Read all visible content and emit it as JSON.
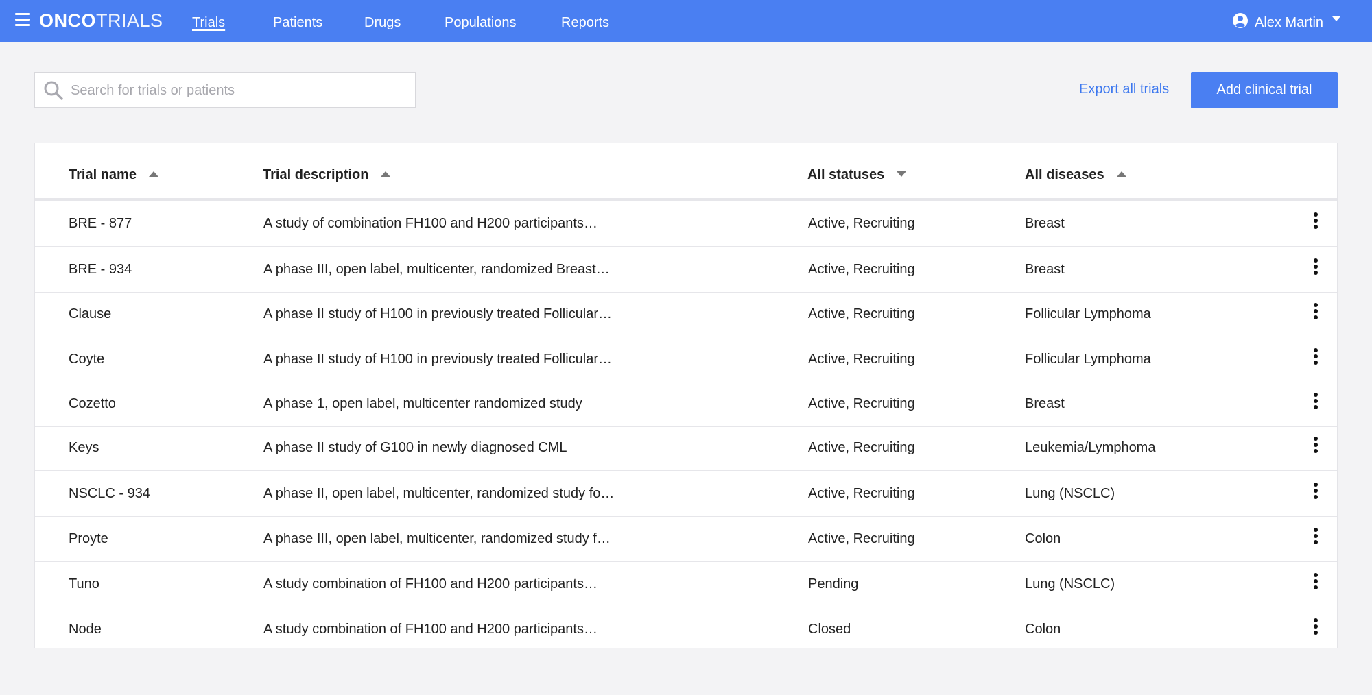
{
  "app": {
    "logo_bold": "ONCO",
    "logo_light": "TRIALS"
  },
  "nav": {
    "items": [
      "Trials",
      "Patients",
      "Drugs",
      "Populations",
      "Reports"
    ],
    "active": "Trials"
  },
  "user": {
    "name": "Alex Martin",
    "icon": "user-circle-icon"
  },
  "toolbar": {
    "search_placeholder": "Search for trials or patients",
    "search_value": "",
    "export_label": "Export all trials",
    "add_label": "Add clinical trial"
  },
  "table": {
    "headers": [
      {
        "label": "Trial name",
        "sort": "asc"
      },
      {
        "label": "Trial description",
        "sort": "asc"
      },
      {
        "label": "All statuses",
        "sort": "desc"
      },
      {
        "label": "All diseases",
        "sort": "asc"
      }
    ],
    "rows": [
      {
        "name": "BRE - 877",
        "description": "A study of combination FH100 and H200 participants…",
        "status": "Active, Recruiting",
        "disease": "Breast"
      },
      {
        "name": "BRE - 934",
        "description": "A phase III, open label, multicenter, randomized Breast…",
        "status": "Active, Recruiting",
        "disease": "Breast"
      },
      {
        "name": "Clause",
        "description": "A phase II study of H100 in previously treated Follicular…",
        "status": "Active, Recruiting",
        "disease": "Follicular Lymphoma"
      },
      {
        "name": "Coyte",
        "description": "A phase II study of H100 in previously treated Follicular…",
        "status": "Active, Recruiting",
        "disease": "Follicular Lymphoma"
      },
      {
        "name": "Cozetto",
        "description": "A phase 1, open label, multicenter randomized study",
        "status": "Active, Recruiting",
        "disease": "Breast"
      },
      {
        "name": "Keys",
        "description": "A phase II study of G100 in newly diagnosed CML",
        "status": "Active, Recruiting",
        "disease": "Leukemia/Lymphoma"
      },
      {
        "name": "NSCLC - 934",
        "description": "A phase II, open label, multicenter, randomized study fo…",
        "status": "Active, Recruiting",
        "disease": "Lung (NSCLC)"
      },
      {
        "name": "Proyte",
        "description": "A phase III, open label, multicenter, randomized study f…",
        "status": "Active, Recruiting",
        "disease": "Colon"
      },
      {
        "name": "Tuno",
        "description": "A study combination of FH100 and H200 participants…",
        "status": "Pending",
        "disease": "Lung (NSCLC)"
      },
      {
        "name": "Node",
        "description": "A study combination of FH100 and H200 participants…",
        "status": "Closed",
        "disease": "Colon"
      }
    ]
  },
  "colors": {
    "brand": "#4a7ff2",
    "link": "#3d78ef",
    "background": "#f3f3f5"
  }
}
